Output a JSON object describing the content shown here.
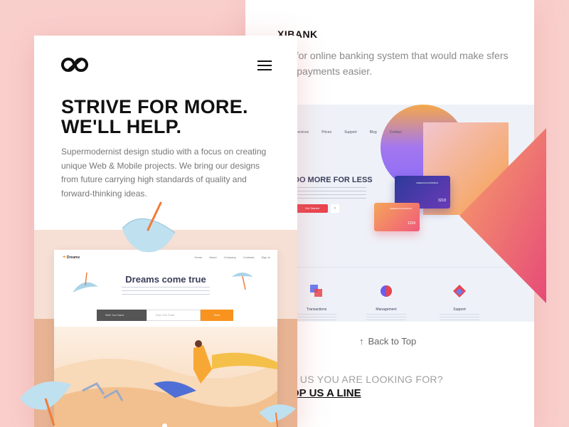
{
  "back": {
    "brand": "XIBANK",
    "description": "site for online banking system that would make sfers and payments easier.",
    "preview": {
      "nav": [
        "Services",
        "Prices",
        "Support",
        "Blog",
        "Contact"
      ],
      "headline": "DO MORE FOR LESS",
      "cta": "Get Started",
      "card1": {
        "label": "AMERICAN EXPRESS",
        "number": "3218"
      },
      "card2": {
        "label": "AMERICAN EXPRESS",
        "number": "1234"
      },
      "features": [
        {
          "label": "Transactions",
          "icon": "transactions-icon"
        },
        {
          "label": "Management",
          "icon": "management-icon"
        },
        {
          "label": "Support",
          "icon": "support-icon"
        }
      ]
    },
    "back_to_top": "Back to Top",
    "contact_question": "T US YOU ARE LOOKING FOR?",
    "contact_cta": "OP US A LINE"
  },
  "front": {
    "headline_line1": "STRIVE FOR MORE.",
    "headline_line2": "WE'LL HELP.",
    "intro": "Supermodernist design studio with a focus on creating unique Web & Mobile projects. We bring our designs from future carrying high standards of quality and forward-thinking ideas.",
    "mini": {
      "brand": "Dreams",
      "nav": [
        "Home",
        "About",
        "Company",
        "Contacts",
        "Sign In"
      ],
      "title": "Dreams come true",
      "name_placeholder": "Write Your Name",
      "email_placeholder": "Enter Your Email",
      "send": "Send"
    }
  },
  "colors": {
    "background": "#f9cfcc",
    "accent_red": "#e8454f",
    "accent_orange": "#f7931e",
    "purple": "#8a6cf5"
  }
}
